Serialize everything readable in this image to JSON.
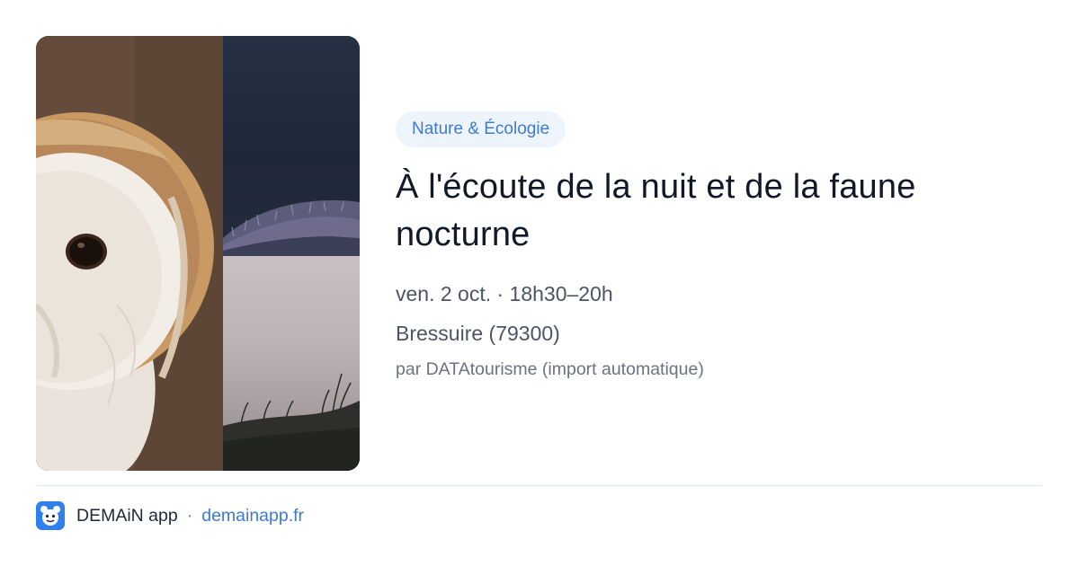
{
  "category": {
    "label": "Nature & Écologie"
  },
  "event": {
    "title": "À l'écoute de la nuit et de la faune nocturne",
    "date_time": "ven. 2 oct. · 18h30–20h",
    "location": "Bressuire (79300)",
    "source": "par DATAtourisme (import automatique)"
  },
  "images": [
    {
      "name": "barn-owl-photo"
    },
    {
      "name": "night-meadow-photo"
    },
    {
      "name": "dusk-grass-photo"
    }
  ],
  "footer": {
    "app_name": "DEMAiN app",
    "separator": "·",
    "link": "demainapp.fr",
    "app_icon": "demain-app-icon"
  },
  "colors": {
    "accent": "#3d7bd1",
    "badge_background": "#eef4fc",
    "title": "#111827",
    "meta_text": "#4b5563",
    "divider": "#dbe3ec"
  }
}
